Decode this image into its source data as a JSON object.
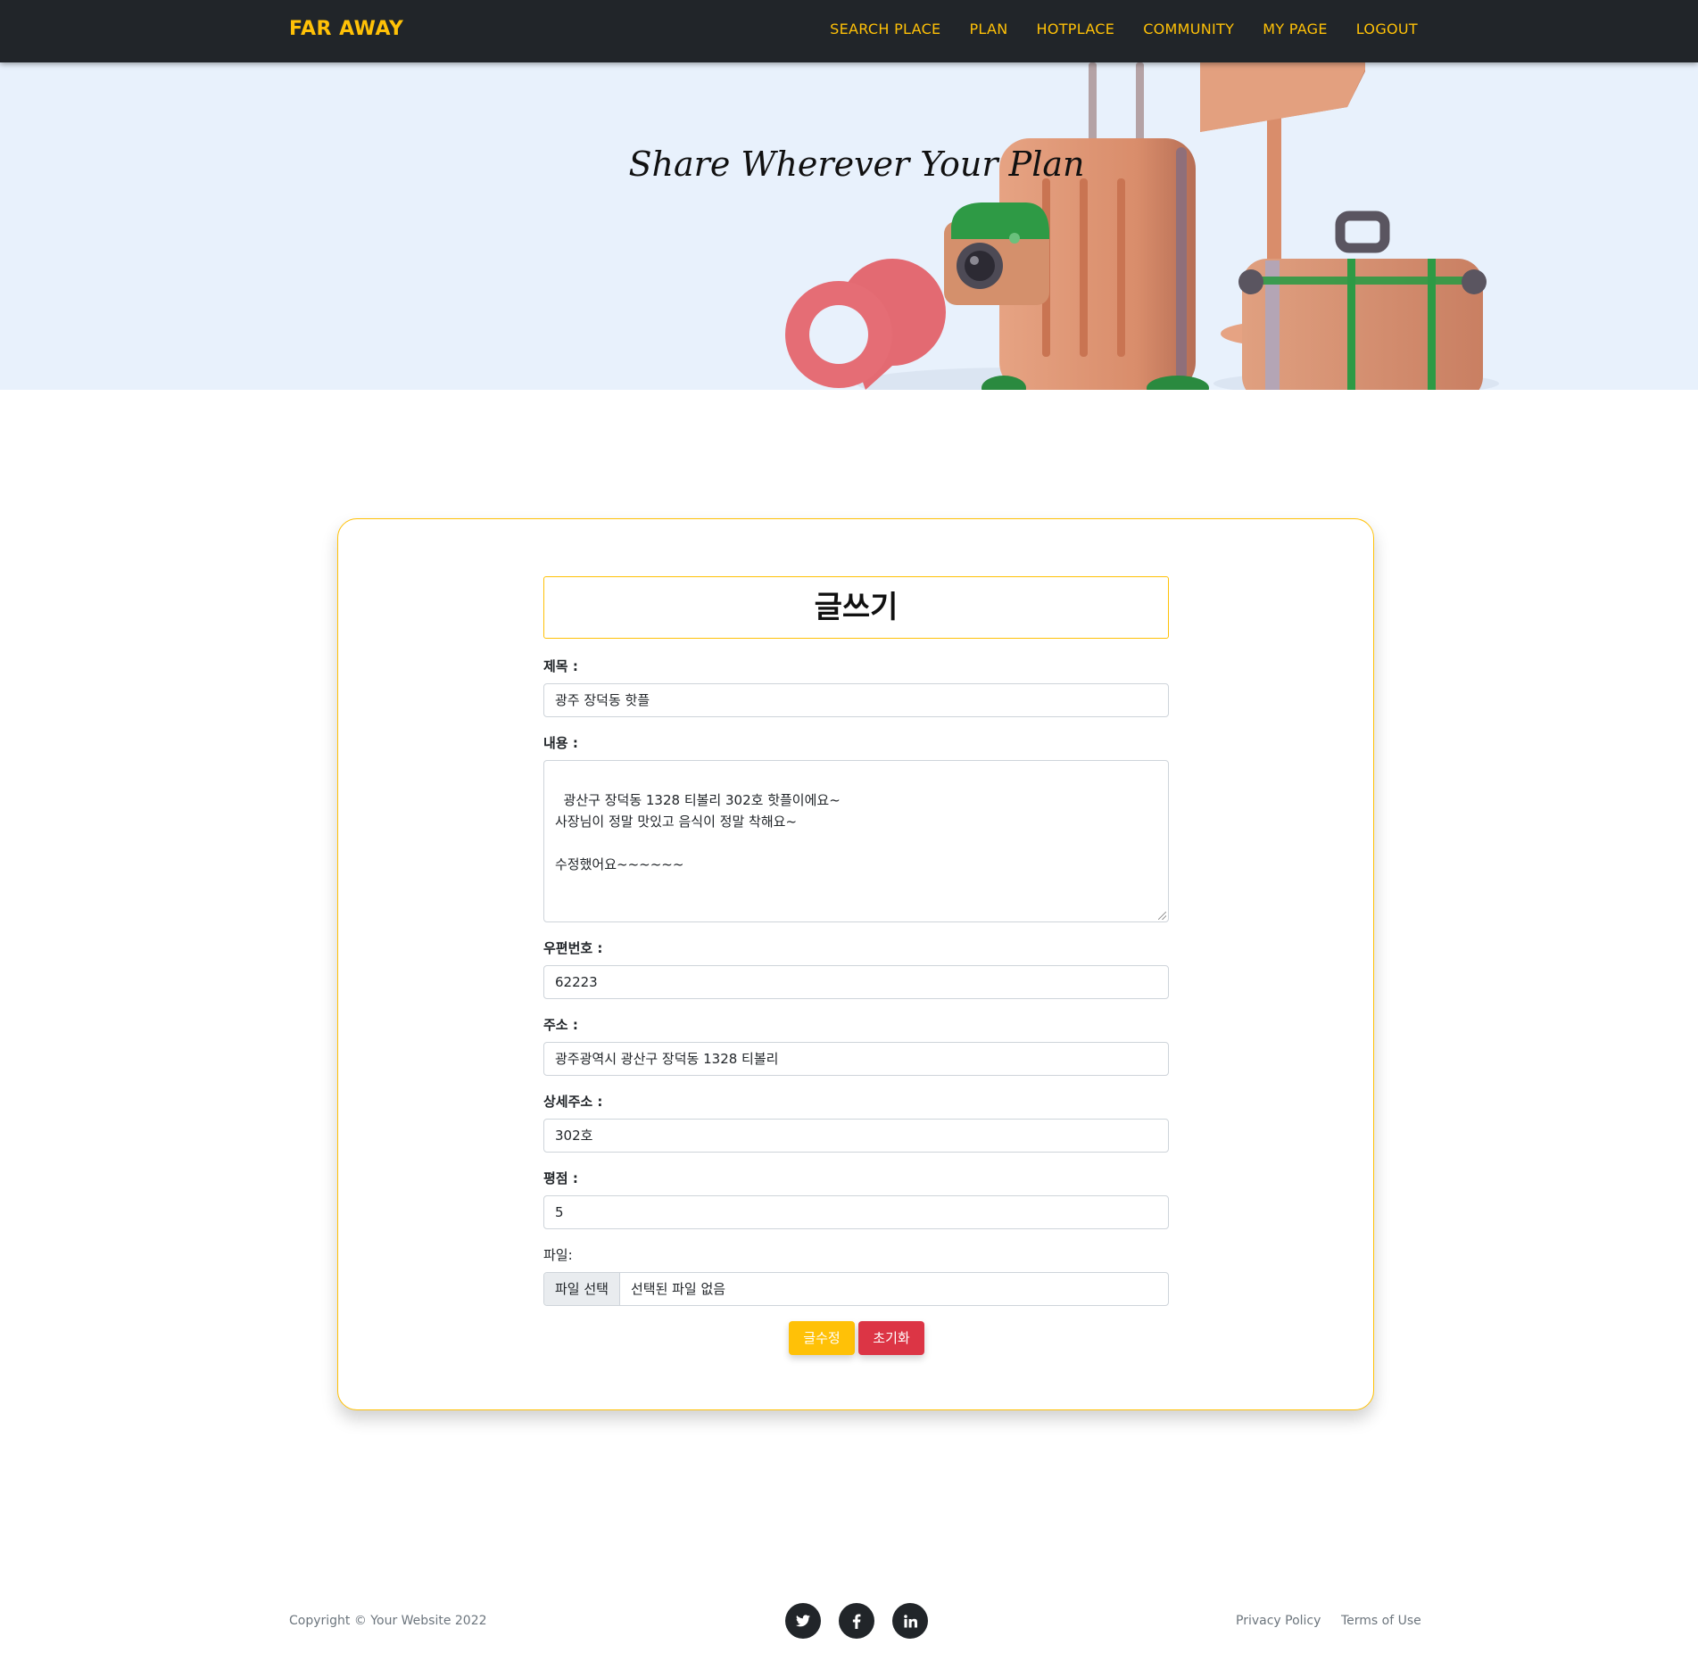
{
  "navbar": {
    "brand": "FAR AWAY",
    "items": [
      "SEARCH PLACE",
      "PLAN",
      "HOTPLACE",
      "COMMUNITY",
      "MY PAGE",
      "LOGOUT"
    ]
  },
  "hero": {
    "title": "Share Wherever Your Plan"
  },
  "form": {
    "heading": "글쓰기",
    "title_label": "제목 :",
    "title_value": "광주 장덕동 핫플",
    "content_label": "내용 :",
    "content_value": "광산구 장덕동 1328 티볼리 302호 핫플이에요~\n사장님이 정말 맛있고 음식이 정말 착해요~\n\n수정했어요~~~~~~",
    "zipcode_label": "우편번호 :",
    "zipcode_value": "62223",
    "address_label": "주소 :",
    "address_value": "광주광역시 광산구 장덕동 1328 티볼리",
    "detail_label": "상세주소 :",
    "detail_value": "302호",
    "rating_label": "평점 :",
    "rating_value": "5",
    "file_label": "파일:",
    "file_button": "파일 선택",
    "file_status": "선택된 파일 없음",
    "submit_label": "글수정",
    "reset_label": "초기화"
  },
  "footer": {
    "copyright": "Copyright © Your Website 2022",
    "social_icons": [
      "twitter-icon",
      "facebook-icon",
      "linkedin-icon"
    ],
    "privacy": "Privacy Policy",
    "terms": "Terms of Use"
  },
  "colors": {
    "accent": "#ffc107",
    "danger": "#dc3545",
    "navbar": "#212529",
    "hero_bg": "#e8f1fc"
  }
}
